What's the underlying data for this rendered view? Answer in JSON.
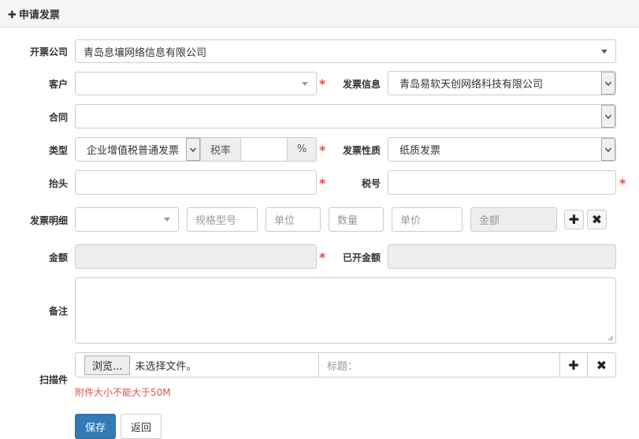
{
  "header": {
    "title": "申请发票"
  },
  "labels": {
    "company": "开票公司",
    "customer": "客户",
    "invoice_info": "发票信息",
    "contract": "合同",
    "type": "类型",
    "tax_rate": "税率",
    "invoice_nature": "发票性质",
    "title": "抬头",
    "tax_no": "税号",
    "details": "发票明细",
    "amount": "金额",
    "issued_amount": "已开金额",
    "remark": "备注",
    "scan": "扫描件"
  },
  "values": {
    "company": "青岛息壤网络信息有限公司",
    "invoice_info": "青岛易软天创网络科技有限公司",
    "type": "企业增值税普通发票",
    "percent": "%",
    "invoice_nature": "纸质发票"
  },
  "placeholders": {
    "spec": "规格型号",
    "unit": "单位",
    "quantity": "数量",
    "price": "单价",
    "amount": "金额",
    "file_title": "标题："
  },
  "file": {
    "browse": "浏览...",
    "status": "未选择文件。",
    "hint": "附件大小不能大于50M"
  },
  "required_mark": "*",
  "buttons": {
    "save": "保存",
    "back": "返回"
  },
  "icons": {
    "add": "plus-icon",
    "remove": "close-icon",
    "dropdown": "caret-down-icon"
  },
  "colors": {
    "primary": "#337ab7",
    "required": "#d9534f",
    "hint": "#d9534f",
    "disabled_bg": "#eeeeee"
  }
}
